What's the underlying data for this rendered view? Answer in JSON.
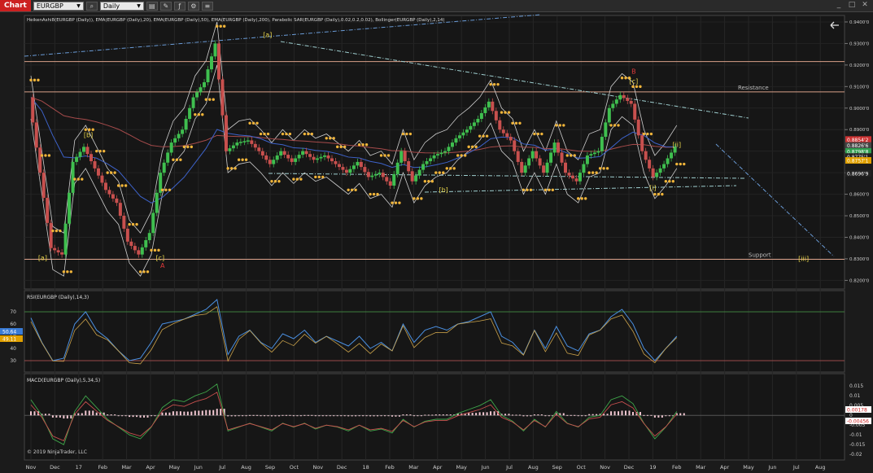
{
  "toolbar": {
    "chart_tab": "Chart",
    "instrument": "EURGBP",
    "interval": "Daily"
  },
  "price_panel": {
    "indicator_label": "HeikenAshi8(EURGBP (Daily)), EMA(EURGBP (Daily),20), EMA(EURGBP (Daily),50), EMA(EURGBP (Daily),200), Parabolic SAR(EURGBP (Daily),0.02,0.2,0.02), Bollinger(EURGBP (Daily),2,14)",
    "y_ticks": [
      "0.9400'0",
      "0.9300'0",
      "0.9200'0",
      "0.9100'0",
      "0.9000'0",
      "0.8900'0",
      "0.8800'0",
      "0.8700'0",
      "0.8600'0",
      "0.8500'0",
      "0.8400'0",
      "0.8300'0",
      "0.8200'0"
    ],
    "price_badges": [
      {
        "label": "0.8854'2",
        "color": "#cc3333",
        "value": 0.88542
      },
      {
        "label": "0.8826'6",
        "color": "#444444",
        "value": 0.88266
      },
      {
        "label": "0.8798'8",
        "color": "#2f9e4f",
        "value": 0.87988
      },
      {
        "label": "0.8775'1",
        "color": "#222222",
        "value": 0.87751
      },
      {
        "label": "0.8757'1",
        "color": "#e0a000",
        "value": 0.87571
      },
      {
        "label": "0.8696'9",
        "color": "#222222",
        "value": 0.86969
      }
    ],
    "levels": [
      {
        "name": "Resistance",
        "value": 0.9075,
        "color": "#d9a089"
      },
      {
        "name": "Support",
        "value": 0.8298,
        "color": "#d9a089"
      },
      {
        "name": "",
        "value": 0.9216,
        "color": "#d9a089"
      }
    ],
    "wave_labels": [
      {
        "text": "[a]",
        "i": 0.49,
        "price": 0.8295,
        "color": "#e6d34a"
      },
      {
        "text": "[b]",
        "i": 2.4,
        "price": 0.8865,
        "color": "#e6d34a"
      },
      {
        "text": "[c]",
        "i": 5.4,
        "price": 0.8295,
        "color": "#e6d34a"
      },
      {
        "text": "A",
        "i": 5.5,
        "price": 0.8258,
        "color": "#e03a3a"
      },
      {
        "text": "[a]",
        "i": 9.89,
        "price": 0.933,
        "color": "#e6d34a"
      },
      {
        "text": "[b]",
        "i": 17.25,
        "price": 0.861,
        "color": "#e6d34a"
      },
      {
        "text": "B",
        "i": 25.2,
        "price": 0.916,
        "color": "#e03a3a"
      },
      {
        "text": "[c]",
        "i": 25.2,
        "price": 0.9115,
        "color": "#e6d34a"
      },
      {
        "text": "[i]",
        "i": 26.0,
        "price": 0.862,
        "color": "#e6d34a"
      },
      {
        "text": "[ii]",
        "i": 27.0,
        "price": 0.882,
        "color": "#e6d34a"
      },
      {
        "text": "[iii]",
        "i": 32.3,
        "price": 0.829,
        "color": "#e6d34a"
      }
    ],
    "ylim": [
      0.8175,
      0.9415
    ]
  },
  "rsi_panel": {
    "label": "RSI(EURGBP (Daily),14,3)",
    "y_ticks": [
      "70",
      "60",
      "50",
      "40",
      "30"
    ],
    "badges": [
      {
        "label": "50.64",
        "color": "#3a7bd5"
      },
      {
        "label": "49.11",
        "color": "#e0a000"
      }
    ],
    "overbought": 70,
    "oversold": 30
  },
  "macd_panel": {
    "label": "MACD(EURGBP (Daily),5,34,5)",
    "y_ticks": [
      "0.015",
      "0.01",
      "0.005",
      "0",
      "-0.005",
      "-0.01",
      "-0.015",
      "-0.02"
    ],
    "badges": [
      {
        "label": "0.00178",
        "color": "#ffffff"
      },
      {
        "label": "-0.00456",
        "color": "#ffffff"
      }
    ],
    "copyright": "© 2019 NinjaTrader, LLC"
  },
  "x_axis": {
    "labels": [
      "Nov",
      "Dec",
      "17",
      "Feb",
      "Mar",
      "Apr",
      "May",
      "Jun",
      "Jul",
      "Aug",
      "Sep",
      "Oct",
      "Nov",
      "Dec",
      "18",
      "Feb",
      "Mar",
      "Apr",
      "May",
      "Jun",
      "Jul",
      "Aug",
      "Sep",
      "Oct",
      "Nov",
      "Dec",
      "19",
      "Feb",
      "Mar",
      "Apr",
      "May",
      "Jun",
      "Jul",
      "Aug"
    ]
  },
  "chart_data": {
    "type": "line",
    "title": "",
    "series": [
      {
        "values": [
          0.905,
          0.87,
          0.835,
          0.832,
          0.875,
          0.882,
          0.872,
          0.862,
          0.856,
          0.838,
          0.832,
          0.842,
          0.87,
          0.884,
          0.89,
          0.905,
          0.912,
          0.93,
          0.88,
          0.884,
          0.885,
          0.88,
          0.874,
          0.88,
          0.875,
          0.88,
          0.876,
          0.878,
          0.874,
          0.87,
          0.875,
          0.868,
          0.87,
          0.864,
          0.88,
          0.866,
          0.874,
          0.878,
          0.88,
          0.886,
          0.89,
          0.895,
          0.903,
          0.89,
          0.885,
          0.87,
          0.88,
          0.87,
          0.884,
          0.87,
          0.866,
          0.878,
          0.88,
          0.9,
          0.906,
          0.902,
          0.88,
          0.868,
          0.874,
          0.882
        ]
      }
    ],
    "rsi_values": [
      65,
      45,
      30,
      32,
      60,
      70,
      55,
      48,
      38,
      30,
      32,
      45,
      60,
      62,
      64,
      68,
      72,
      80,
      35,
      50,
      55,
      45,
      40,
      52,
      48,
      55,
      45,
      50,
      46,
      42,
      50,
      40,
      45,
      38,
      60,
      45,
      55,
      58,
      55,
      60,
      62,
      66,
      70,
      50,
      45,
      35,
      55,
      40,
      58,
      42,
      38,
      52,
      55,
      66,
      72,
      60,
      40,
      30,
      40,
      50
    ],
    "macd_values": [
      0.008,
      0.0,
      -0.012,
      -0.015,
      0.002,
      0.01,
      0.004,
      -0.002,
      -0.006,
      -0.01,
      -0.012,
      -0.006,
      0.004,
      0.008,
      0.007,
      0.01,
      0.012,
      0.016,
      -0.008,
      -0.006,
      -0.004,
      -0.006,
      -0.008,
      -0.004,
      -0.006,
      -0.004,
      -0.007,
      -0.005,
      -0.006,
      -0.008,
      -0.005,
      -0.008,
      -0.007,
      -0.009,
      -0.002,
      -0.006,
      -0.003,
      -0.002,
      -0.002,
      0.001,
      0.003,
      0.005,
      0.008,
      0.0,
      -0.003,
      -0.008,
      -0.002,
      -0.006,
      0.002,
      -0.004,
      -0.006,
      -0.001,
      0.0,
      0.008,
      0.01,
      0.006,
      -0.004,
      -0.012,
      -0.006,
      0.002
    ]
  }
}
